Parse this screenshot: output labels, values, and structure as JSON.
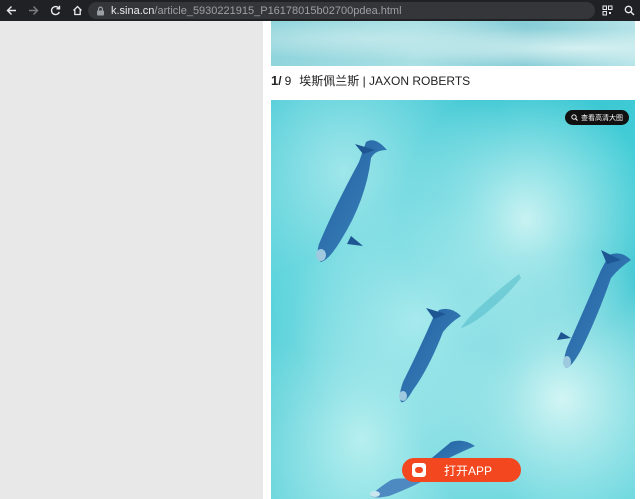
{
  "browser": {
    "url_host": "k.sina.cn",
    "url_path": "/article_5930221915_P16178015b02700pdea.html"
  },
  "article": {
    "caption": {
      "current": "1",
      "separator": "/",
      "total": "9",
      "text": "埃斯佩兰斯 | JAXON ROBERTS"
    },
    "hd_button_label": "查看高清大图",
    "open_app_label": "打开APP"
  },
  "colors": {
    "accent": "#f2471f",
    "toolbar_bg": "#202124",
    "water": "#3fc6d2"
  }
}
